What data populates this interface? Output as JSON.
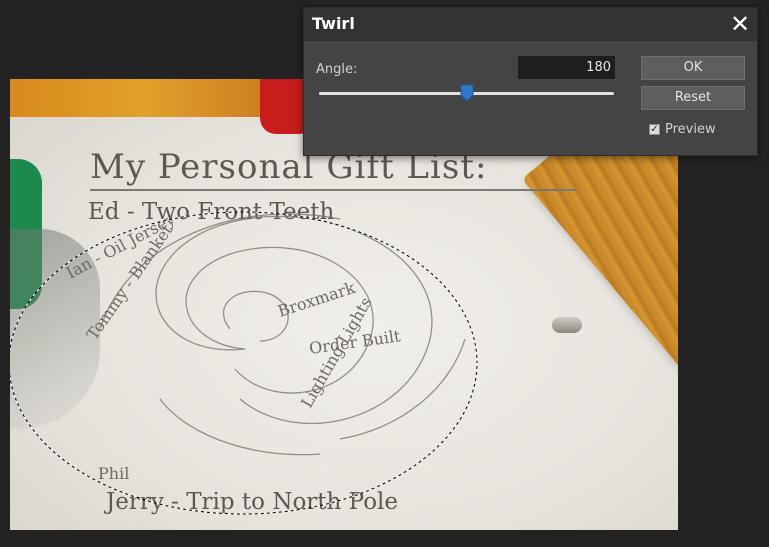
{
  "dialog": {
    "title": "Twirl",
    "close_icon": "close-icon",
    "angle_label": "Angle:",
    "angle_value": "180",
    "slider": {
      "value": 180,
      "min": -360,
      "max": 720
    },
    "ok_label": "OK",
    "reset_label": "Reset",
    "preview_label": "Preview",
    "preview_checked": true
  },
  "canvas": {
    "title_text": "My Personal Gift List:",
    "line1_text": "Ed - Two Front Teeth",
    "last_line_text": "Jerry - Trip to North Pole",
    "swirl_fragments": [
      "Ian - Oil Jersey",
      "Tommy - Blanket",
      "Broxmark",
      "Order Built",
      "Lighting Lights",
      "Phil"
    ],
    "selection": "elliptical marquee"
  },
  "colors": {
    "accent": "#2d78c8",
    "dialog_bg": "#444444",
    "header_bg": "#333333",
    "app_bg": "#232323"
  }
}
